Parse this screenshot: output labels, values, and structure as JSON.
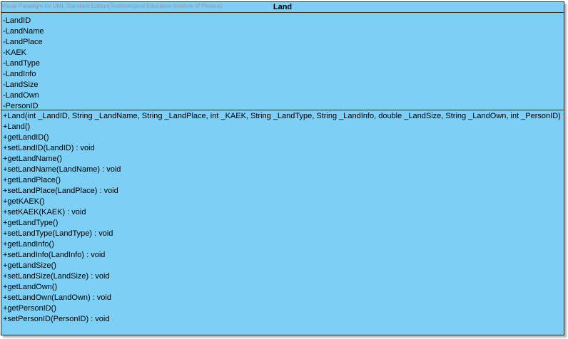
{
  "diagram": {
    "watermark": "Visual Paradigm for UML Standard Edition(Technological Education Institute of Piraeus)",
    "class_name": "Land",
    "attributes": [
      "-LandID",
      "-LandName",
      "-LandPlace",
      "-KAEK",
      "-LandType",
      "-LandInfo",
      "-LandSize",
      "-LandOwn",
      "-PersonID"
    ],
    "operations": [
      "+Land(int _LandID, String _LandName, String _LandPlace, int _KAEK, String _LandType, String _LandInfo, double _LandSize, String _LandOwn, int _PersonID)",
      "+Land()",
      "+getLandID()",
      "+setLandID(LandID) : void",
      "+getLandName()",
      "+setLandName(LandName) : void",
      "+getLandPlace()",
      "+setLandPlace(LandPlace) : void",
      "+getKAEK()",
      "+setKAEK(KAEK) : void",
      "+getLandType()",
      "+setLandType(LandType) : void",
      "+getLandInfo()",
      "+setLandInfo(LandInfo) : void",
      "+getLandSize()",
      "+setLandSize(LandSize) : void",
      "+getLandOwn()",
      "+setLandOwn(LandOwn) : void",
      "+getPersonID()",
      "+setPersonID(PersonID) : void"
    ],
    "colors": {
      "class_fill": "#7ecff5",
      "border": "#2b2b2b",
      "watermark_text": "#8a9aa6"
    }
  }
}
